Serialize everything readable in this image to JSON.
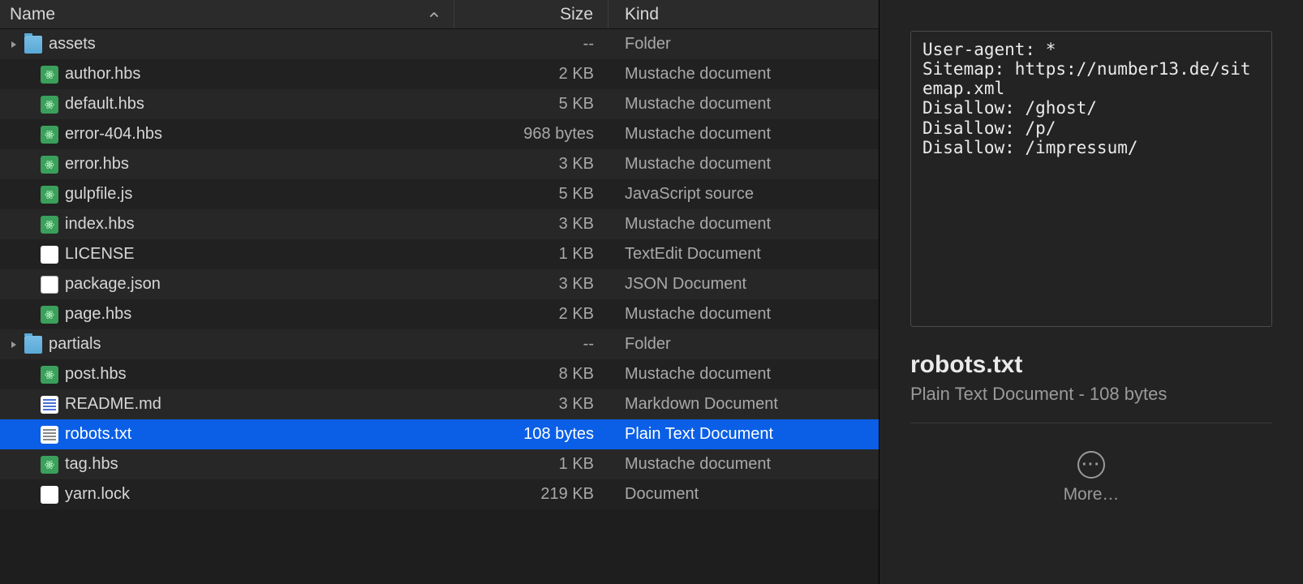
{
  "columns": {
    "name": "Name",
    "size": "Size",
    "kind": "Kind"
  },
  "sort": {
    "column": "name",
    "direction": "asc"
  },
  "files": [
    {
      "name": "assets",
      "size": "--",
      "kind": "Folder",
      "icon": "folder",
      "disclosure": true
    },
    {
      "name": "author.hbs",
      "size": "2 KB",
      "kind": "Mustache document",
      "icon": "hbs"
    },
    {
      "name": "default.hbs",
      "size": "5 KB",
      "kind": "Mustache document",
      "icon": "hbs"
    },
    {
      "name": "error-404.hbs",
      "size": "968 bytes",
      "kind": "Mustache document",
      "icon": "hbs"
    },
    {
      "name": "error.hbs",
      "size": "3 KB",
      "kind": "Mustache document",
      "icon": "hbs"
    },
    {
      "name": "gulpfile.js",
      "size": "5 KB",
      "kind": "JavaScript source",
      "icon": "js"
    },
    {
      "name": "index.hbs",
      "size": "3 KB",
      "kind": "Mustache document",
      "icon": "hbs"
    },
    {
      "name": "LICENSE",
      "size": "1 KB",
      "kind": "TextEdit Document",
      "icon": "text"
    },
    {
      "name": "package.json",
      "size": "3 KB",
      "kind": "JSON Document",
      "icon": "json"
    },
    {
      "name": "page.hbs",
      "size": "2 KB",
      "kind": "Mustache document",
      "icon": "hbs"
    },
    {
      "name": "partials",
      "size": "--",
      "kind": "Folder",
      "icon": "folder",
      "disclosure": true
    },
    {
      "name": "post.hbs",
      "size": "8 KB",
      "kind": "Mustache document",
      "icon": "hbs"
    },
    {
      "name": "README.md",
      "size": "3 KB",
      "kind": "Markdown Document",
      "icon": "md"
    },
    {
      "name": "robots.txt",
      "size": "108 bytes",
      "kind": "Plain Text Document",
      "icon": "txt",
      "selected": true
    },
    {
      "name": "tag.hbs",
      "size": "1 KB",
      "kind": "Mustache document",
      "icon": "hbs"
    },
    {
      "name": "yarn.lock",
      "size": "219 KB",
      "kind": "Document",
      "icon": "text"
    }
  ],
  "preview": {
    "content": "User-agent: *\nSitemap: https://number13.de/sitemap.xml\nDisallow: /ghost/\nDisallow: /p/\nDisallow: /impressum/",
    "title": "robots.txt",
    "subtitle": "Plain Text Document - 108 bytes"
  },
  "more_label": "More…"
}
